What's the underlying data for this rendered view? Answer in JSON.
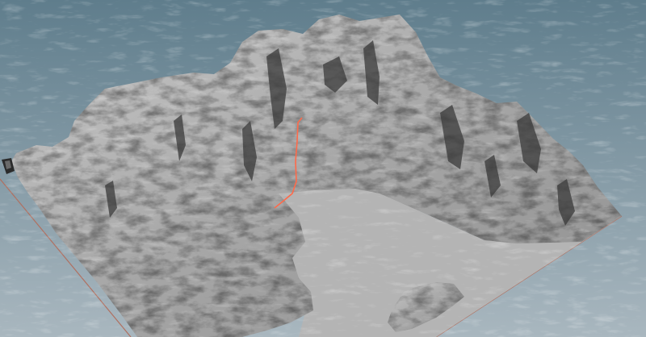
{
  "viewport": {
    "background_top": "#5f7d8c",
    "background_bottom": "#a9b7bf"
  },
  "terrain": {
    "surface_color": "#a7a7a7",
    "highlight_color": "#e0e0e0",
    "shadow_color": "#3a3a3a",
    "flat_plane_color": "#b4b4b4"
  },
  "grid": {
    "edge_line_color": "#b07060"
  },
  "path": {
    "color": "#ff6a4a"
  }
}
